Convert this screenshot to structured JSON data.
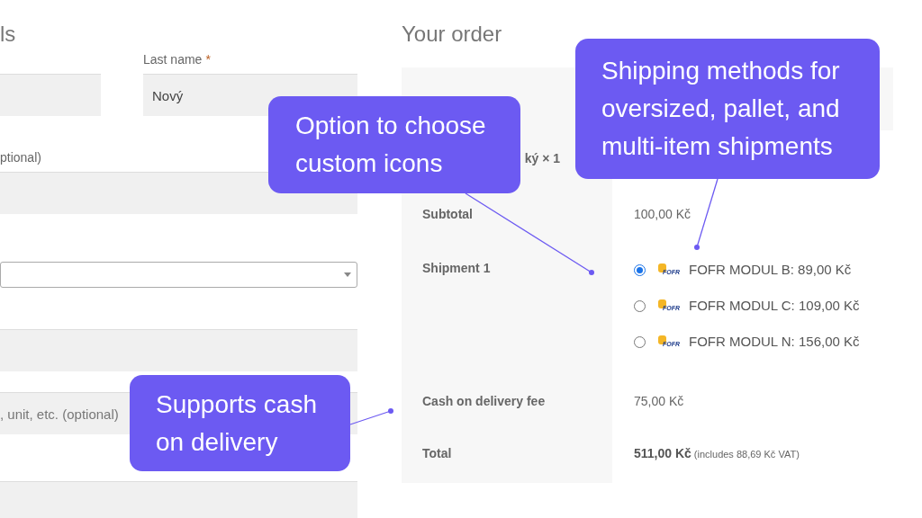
{
  "billing": {
    "heading": "ls",
    "fields": [
      {
        "kind": "short"
      },
      {
        "label": "Last name",
        "required_mark": "*",
        "value": "Nový",
        "kind": "wide"
      },
      {
        "label": "ptional)",
        "kind": "text"
      },
      {
        "kind": "select"
      },
      {
        "kind": "text"
      },
      {
        "placeholder": ", unit, etc. (optional)",
        "kind": "text"
      },
      {
        "kind": "text"
      }
    ]
  },
  "order": {
    "heading": "Your order",
    "rows": [
      {
        "kind": "header"
      },
      {
        "kind": "product",
        "value": "ký × 1"
      },
      {
        "kind": "plain",
        "label": "Subtotal",
        "value": "100,00 Kč"
      },
      {
        "kind": "shipping",
        "label": "Shipment 1",
        "methods": [
          {
            "logo": "FOFR",
            "label": "FOFR MODUL B: 89,00 Kč",
            "selected": true
          },
          {
            "logo": "FOFR",
            "label": "FOFR MODUL C: 109,00 Kč",
            "selected": false
          },
          {
            "logo": "FOFR",
            "label": "FOFR MODUL N: 156,00 Kč",
            "selected": false
          }
        ]
      },
      {
        "kind": "plain",
        "label": "Cash on delivery fee",
        "value": "75,00 Kč"
      },
      {
        "kind": "total",
        "label": "Total",
        "value": "511,00 Kč",
        "note": "(includes 88,69 Kč VAT)"
      }
    ]
  },
  "callouts": [
    {
      "text": "Option to choose custom icons"
    },
    {
      "text": "Shipping methods for oversized, pallet, and multi-item shipments"
    },
    {
      "text": "Supports cash on delivery"
    }
  ]
}
